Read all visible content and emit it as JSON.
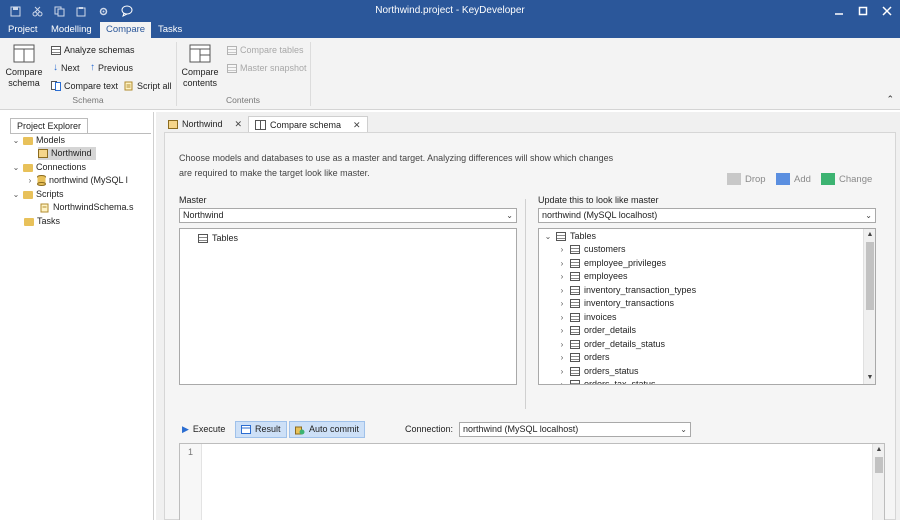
{
  "window": {
    "title": "Northwind.project - KeyDeveloper"
  },
  "menu": {
    "tabs": [
      "Project",
      "Modelling",
      "Compare",
      "Tasks"
    ],
    "active": "Compare"
  },
  "ribbon": {
    "compare_schema": "Compare\nschema",
    "analyze_schemas": "Analyze schemas",
    "next": "Next",
    "previous": "Previous",
    "compare_text": "Compare text",
    "script_all": "Script all",
    "group_schema": "Schema",
    "compare_contents": "Compare\ncontents",
    "compare_tables": "Compare tables",
    "master_snapshot": "Master snapshot",
    "group_contents": "Contents"
  },
  "explorer": {
    "tab": "Project Explorer",
    "models": "Models",
    "northwind_model": "Northwind",
    "connections": "Connections",
    "connection_item": "northwind (MySQL l",
    "scripts": "Scripts",
    "script_item": "NorthwindSchema.s",
    "tasks": "Tasks"
  },
  "doc_tabs": {
    "northwind": "Northwind",
    "compare_schema": "Compare schema"
  },
  "compare": {
    "description_line1": "Choose models and databases to use as a master and target. Analyzing differences will show which changes",
    "description_line2": "are required to make the target look like master.",
    "legend": {
      "drop": "Drop",
      "add": "Add",
      "change": "Change"
    },
    "colors": {
      "drop": "#c8c8c8",
      "add": "#5b8fe0",
      "change": "#3cb371"
    },
    "master_label": "Master",
    "master_value": "Northwind",
    "master_tree_root": "Tables",
    "target_label": "Update this to look like master",
    "target_value": "northwind (MySQL localhost)",
    "target_tree_root": "Tables",
    "target_tables": [
      "customers",
      "employee_privileges",
      "employees",
      "inventory_transaction_types",
      "inventory_transactions",
      "invoices",
      "order_details",
      "order_details_status",
      "orders",
      "orders_status",
      "orders_tax_status"
    ]
  },
  "query": {
    "execute": "Execute",
    "result": "Result",
    "auto_commit": "Auto commit",
    "connection_label": "Connection:",
    "connection_value": "northwind (MySQL localhost)",
    "line_number": "1"
  }
}
